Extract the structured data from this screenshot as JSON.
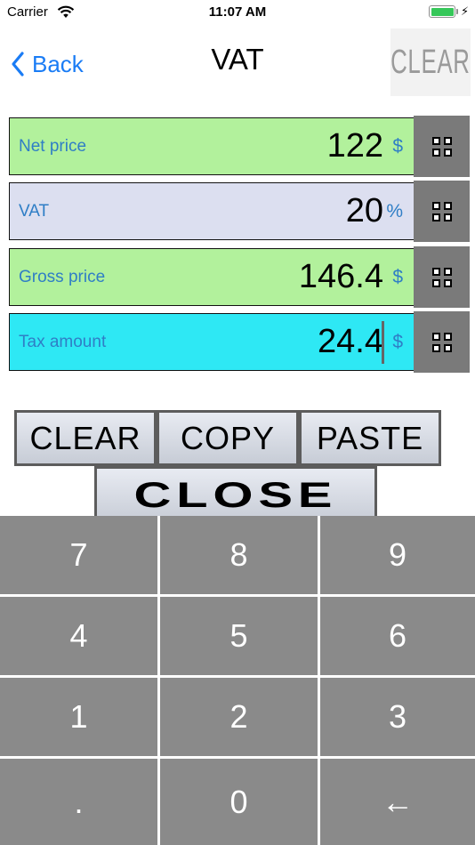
{
  "status_bar": {
    "carrier": "Carrier",
    "time": "11:07 AM",
    "battery_level": 1.0
  },
  "nav": {
    "back_label": "Back",
    "title": "VAT",
    "clear_label": "CLEAR"
  },
  "fields": [
    {
      "label": "Net price",
      "value": "122",
      "unit": "$",
      "color": "#b2f19c"
    },
    {
      "label": "VAT",
      "value": "20",
      "unit": "%",
      "color": "#dcdff0"
    },
    {
      "label": "Gross price",
      "value": "146.4",
      "unit": "$",
      "color": "#b2f19c"
    },
    {
      "label": "Tax amount",
      "value": "24.4",
      "unit": "$",
      "color": "#2ee8f4",
      "focused": true
    }
  ],
  "actions": {
    "clear": "CLEAR",
    "copy": "COPY",
    "paste": "PASTE",
    "close": "CLOSE"
  },
  "keypad": {
    "keys": [
      "7",
      "8",
      "9",
      "4",
      "5",
      "6",
      "1",
      "2",
      "3",
      ".",
      "0",
      "←"
    ]
  },
  "colors": {
    "accent": "#1a7cf5",
    "label_blue": "#2f7ec6",
    "key_bg": "#8a8a8a",
    "grid_button_bg": "#7a7a7a"
  }
}
